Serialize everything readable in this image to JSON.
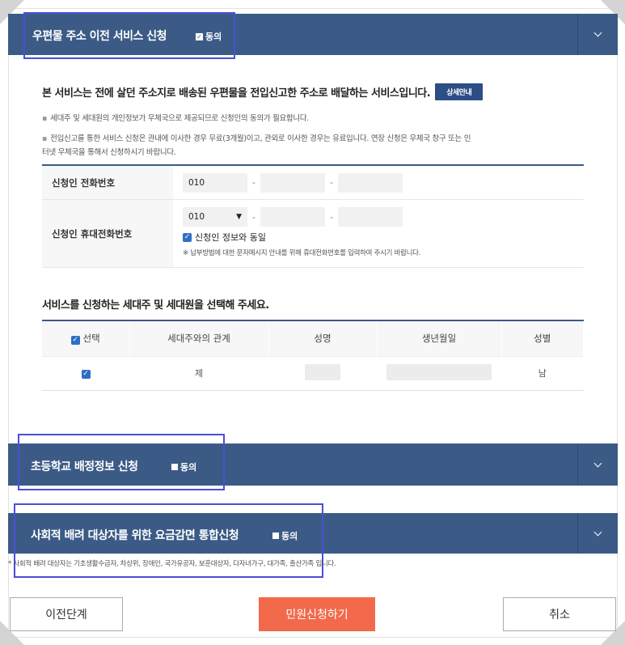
{
  "sections": {
    "postal": {
      "title": "우편물 주소 이전 서비스 신청",
      "agree_label": "동의",
      "agree_checked": true
    },
    "school": {
      "title": "초등학교 배정정보 신청",
      "agree_label": "동의",
      "agree_checked": false
    },
    "social": {
      "title": "사회적 배려 대상자를 위한 요금감면 통합신청",
      "agree_label": "동의",
      "agree_checked": false
    }
  },
  "intro": {
    "text": "본 서비스는 전에 살던 주소지로 배송된 우편물을 전입신고한 주소로 배달하는 서비스입니다.",
    "detail_button": "상세안내"
  },
  "notes": {
    "line1": "세대주 및 세대원의 개인정보가 우체국으로 제공되므로 신청인의 동의가 필요합니다.",
    "line2a": "전입신고를 통한 서비스 신청은 관내에 이사한 경우 무료(3개월)이고, 관외로 이사한 경우는 유료입니다. 연장 신청은 우체국 창구 또는 인",
    "line2b": "터넷 우체국을 통해서 신청하시기 바랍니다."
  },
  "form": {
    "phone_label": "신청인 전화번호",
    "phone_prefix": "010",
    "mobile_label": "신청인 휴대전화번호",
    "mobile_prefix": "010",
    "same_as_applicant_label": "신청인 정보와 동일",
    "mobile_note": "※ 납부방법에 대한 문자메시지 안내를 위해 휴대전화번호를 입력하여 주시기 바랍니다.",
    "dash": "-"
  },
  "household": {
    "heading": "서비스를 신청하는 세대주 및 세대원을 선택해 주세요.",
    "columns": [
      "선택",
      "세대주와의 관계",
      "성명",
      "생년월일",
      "성별"
    ],
    "rows": [
      {
        "selected": true,
        "relation": "제",
        "name": "",
        "birth": "",
        "gender": "남"
      }
    ]
  },
  "footnote": "* 사회적 배려 대상자는 기초생활수급자, 차상위, 장애인, 국가유공자, 보훈대상자, 다자녀가구, 대가족, 출산가족 입니다.",
  "buttons": {
    "prev": "이전단계",
    "submit": "민원신청하기",
    "cancel": "취소"
  },
  "colors": {
    "header_bar": "#3b5b86",
    "submit": "#f26a4b",
    "highlight": "#4b4fd6",
    "checkbox": "#2f6ec4"
  },
  "icons": {
    "toggle": "chevron-down-icon",
    "checkbox": "checkbox-checked-icon"
  }
}
